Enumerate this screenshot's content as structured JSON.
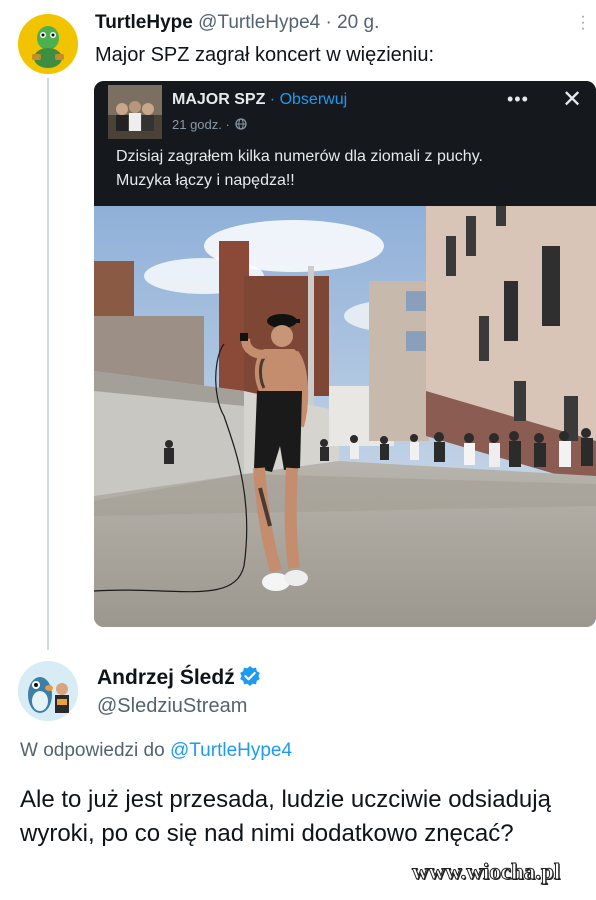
{
  "tweet": {
    "author_name": "TurtleHype",
    "author_handle": "@TurtleHype4",
    "time": "· 20 g.",
    "text": "Major SPZ zagrał koncert w więzieniu:",
    "avatar_icon": "turtle-avatar"
  },
  "embedded_post": {
    "author_name": "MAJOR SPZ",
    "follow_label": "Obserwuj",
    "time": "21 godz. ·",
    "globe_icon": "globe-icon",
    "more_label": "•••",
    "close_label": "✕",
    "text_line1": "Dzisiaj zagrałem kilka numerów dla ziomali z puchy.",
    "text_line2": "Muzyka łączy i napędza!!",
    "photo_icon": "prison-yard-concert-photo"
  },
  "reply": {
    "author_name": "Andrzej Śledź",
    "verified_icon": "verified-badge-icon",
    "author_handle": "@SledziuStream",
    "reply_prefix": "W odpowiedzi do",
    "reply_mention": "@TurtleHype4",
    "text": "Ale to już jest przesada, ludzie uczciwie odsiadują wyroki, po co się nad nimi dodatkowo znęcać?"
  },
  "watermark": "www.wiocha.pl",
  "colors": {
    "link_blue": "#1d9bf0",
    "muted_gray": "#536471",
    "embed_dark": "#15181c",
    "avatar_yellow": "#f2c400"
  }
}
